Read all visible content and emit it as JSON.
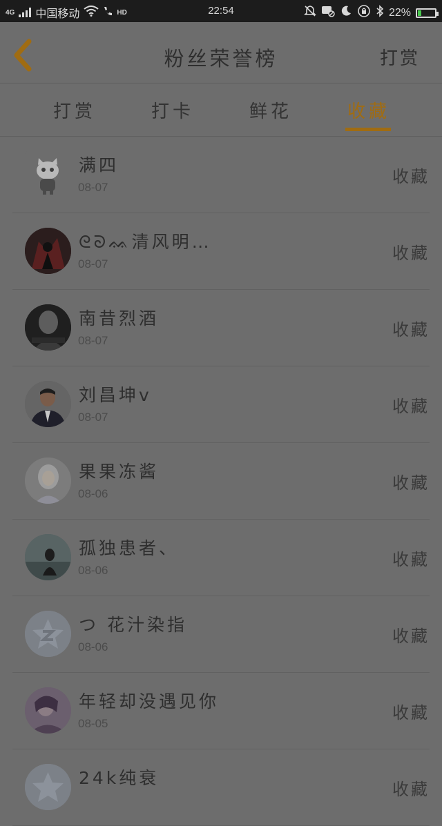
{
  "status_bar": {
    "network": "4G",
    "carrier": "中国移动",
    "hd_label": "HD",
    "time": "22:54",
    "battery": "22%",
    "battery_level": 0.22
  },
  "header": {
    "title": "粉丝荣誉榜",
    "right_action": "打赏"
  },
  "tabs": [
    {
      "label": "打赏"
    },
    {
      "label": "打卡"
    },
    {
      "label": "鲜花"
    },
    {
      "label": "收藏"
    }
  ],
  "active_tab": "收藏",
  "colors": {
    "accent": "#a06c12",
    "background": "#6d6d6d",
    "status_bar": "#1c1c1c"
  },
  "list": [
    {
      "name": "满四",
      "date": "08-07",
      "action": "收藏",
      "avatar": "cartoon-cat"
    },
    {
      "name": "ᘓᘐᨐ清风明…",
      "date": "08-07",
      "action": "收藏",
      "avatar": "dark-red"
    },
    {
      "name": "南昔烈酒",
      "date": "08-07",
      "action": "收藏",
      "avatar": "dark-portrait"
    },
    {
      "name": "刘昌坤v",
      "date": "08-07",
      "action": "收藏",
      "avatar": "man-suit"
    },
    {
      "name": "果果冻酱",
      "date": "08-06",
      "action": "收藏",
      "avatar": "anime-girl"
    },
    {
      "name": "孤独患者、",
      "date": "08-06",
      "action": "收藏",
      "avatar": "girl-scene"
    },
    {
      "name": "つ 花汁染指",
      "date": "08-06",
      "action": "收藏",
      "avatar": "default-star"
    },
    {
      "name": "年轻却没遇见你",
      "date": "08-05",
      "action": "收藏",
      "avatar": "purple-photo"
    },
    {
      "name": "24k纯衰",
      "date": "",
      "action": "收藏",
      "avatar": "default-star"
    }
  ]
}
